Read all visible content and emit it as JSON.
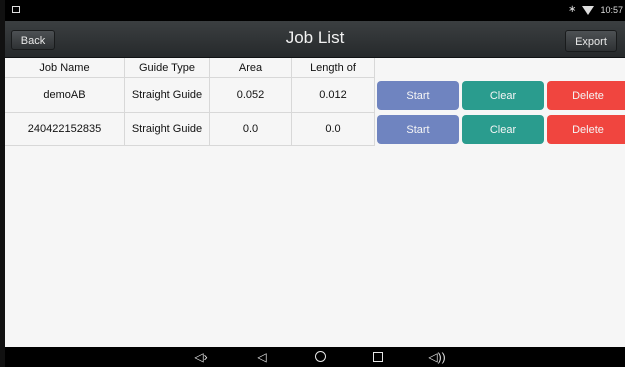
{
  "statusbar": {
    "clock": "10:57"
  },
  "actionbar": {
    "back_label": "Back",
    "title": "Job List",
    "export_label": "Export"
  },
  "table": {
    "columns": [
      "Job Name",
      "Guide Type",
      "Area",
      "Length of"
    ],
    "rows": [
      {
        "job_name": "demoAB",
        "guide_type": "Straight Guide",
        "area": "0.052",
        "length": "0.012"
      },
      {
        "job_name": "240422152835",
        "guide_type": "Straight Guide",
        "area": "0.0",
        "length": "0.0"
      }
    ],
    "actions": {
      "start": "Start",
      "clear": "Clear",
      "delete": "Delete"
    }
  },
  "colors": {
    "start": "#6f84c0",
    "clear": "#2a9c8e",
    "delete": "#f0453f"
  },
  "navbar": {
    "icons": [
      "volume-down-icon",
      "back-triangle-icon",
      "home-circle-icon",
      "recents-square-icon",
      "volume-up-icon"
    ]
  }
}
